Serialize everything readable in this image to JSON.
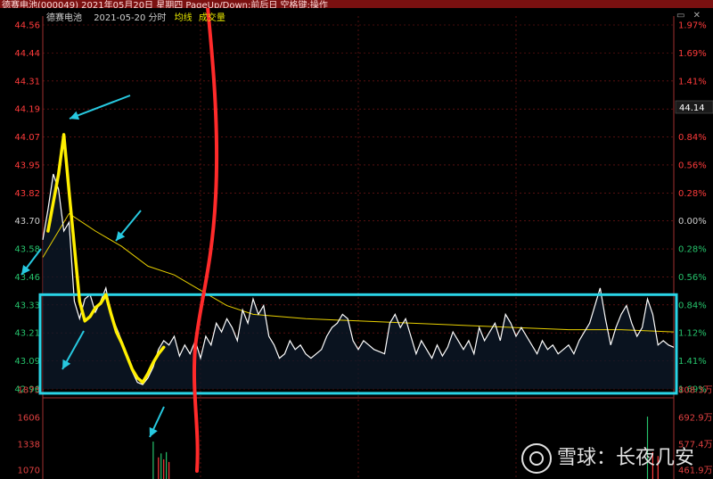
{
  "window": {
    "title": "德赛电池(000049)  2021年05月20日 星期四 PageUp/Down:前后日 空格键:操作"
  },
  "header": {
    "stock": "德赛电池",
    "date_label": "2021-05-20 分时",
    "avg_label": "均线",
    "volume_label": "成交量"
  },
  "price_badge": "44.14",
  "watermark": {
    "site": "雪球",
    "sep": "：",
    "author": "长夜几安"
  },
  "colors": {
    "background": "#000000",
    "grid": "#8b1a1a",
    "price_line": "#ffffff",
    "avg_line": "#e8d000",
    "up": "#ff3b3b",
    "down": "#26c26b",
    "highlight_box": "#2ad4e6",
    "annotation_yellow": "#ffef00",
    "annotation_red": "#ff2a2a",
    "arrow": "#27c9e0"
  },
  "chart_data": {
    "type": "line",
    "left_ticks": [
      "44.56",
      "44.44",
      "44.31",
      "44.19",
      "44.07",
      "43.95",
      "43.82",
      "43.70",
      "43.58",
      "43.46",
      "43.33",
      "43.21",
      "43.09",
      "42.96"
    ],
    "right_ticks": [
      "1.97%",
      "1.69%",
      "1.41%",
      "1.13%",
      "0.84%",
      "0.56%",
      "0.28%",
      "0.00%",
      "0.28%",
      "0.56%",
      "0.84%",
      "1.12%",
      "1.41%",
      "1.69%"
    ],
    "ylim": [
      42.9,
      44.56
    ],
    "volume_ticks_left": [
      "1873",
      "1606",
      "1338",
      "1070"
    ],
    "volume_ticks_right": [
      "808.3万",
      "692.9万",
      "577.4万",
      "461.9万"
    ],
    "x_range": [
      0,
      240
    ],
    "price": {
      "x": [
        0,
        2,
        4,
        6,
        8,
        10,
        12,
        14,
        16,
        18,
        20,
        22,
        24,
        26,
        28,
        30,
        32,
        34,
        36,
        38,
        40,
        42,
        44,
        46,
        48,
        50,
        52,
        54,
        56,
        58,
        60,
        62,
        64,
        66,
        68,
        70,
        72,
        74,
        76,
        78,
        80,
        82,
        84,
        86,
        88,
        90,
        92,
        94,
        96,
        98,
        100,
        102,
        104,
        106,
        108,
        110,
        112,
        114,
        116,
        118,
        120,
        122,
        124,
        126,
        128,
        130,
        132,
        134,
        136,
        138,
        140,
        142,
        144,
        146,
        148,
        150,
        152,
        154,
        156,
        158,
        160,
        162,
        164,
        166,
        168,
        170,
        172,
        174,
        176,
        178,
        180,
        182,
        184,
        186,
        188,
        190,
        192,
        194,
        196,
        198,
        200,
        202,
        204,
        206,
        208,
        210,
        212,
        214,
        216,
        218,
        220,
        222,
        224,
        226,
        228,
        230,
        232,
        234,
        236,
        238,
        240
      ],
      "y": [
        43.58,
        43.72,
        43.88,
        43.81,
        43.62,
        43.66,
        43.3,
        43.22,
        43.31,
        43.33,
        43.25,
        43.3,
        43.36,
        43.24,
        43.18,
        43.12,
        43.05,
        42.98,
        42.93,
        42.92,
        42.95,
        43.0,
        43.08,
        43.12,
        43.1,
        43.14,
        43.05,
        43.1,
        43.06,
        43.12,
        43.04,
        43.14,
        43.1,
        43.2,
        43.16,
        43.22,
        43.18,
        43.12,
        43.26,
        43.2,
        43.31,
        43.24,
        43.28,
        43.14,
        43.1,
        43.04,
        43.06,
        43.12,
        43.08,
        43.1,
        43.06,
        43.04,
        43.06,
        43.08,
        43.14,
        43.18,
        43.2,
        43.24,
        43.22,
        43.12,
        43.08,
        43.12,
        43.1,
        43.08,
        43.07,
        43.06,
        43.2,
        43.24,
        43.18,
        43.22,
        43.14,
        43.06,
        43.12,
        43.08,
        43.04,
        43.1,
        43.05,
        43.09,
        43.16,
        43.12,
        43.08,
        43.12,
        43.06,
        43.18,
        43.12,
        43.16,
        43.2,
        43.12,
        43.24,
        43.2,
        43.14,
        43.18,
        43.14,
        43.1,
        43.06,
        43.12,
        43.08,
        43.1,
        43.06,
        43.08,
        43.1,
        43.06,
        43.12,
        43.16,
        43.2,
        43.28,
        43.36,
        43.22,
        43.1,
        43.18,
        43.24,
        43.28,
        43.2,
        43.14,
        43.18,
        43.31,
        43.24,
        43.1,
        43.12,
        43.1,
        43.09
      ]
    },
    "avg": {
      "x": [
        0,
        10,
        20,
        30,
        40,
        50,
        60,
        70,
        80,
        100,
        120,
        140,
        160,
        180,
        200,
        220,
        240
      ],
      "y": [
        43.5,
        43.7,
        43.62,
        43.55,
        43.46,
        43.42,
        43.35,
        43.28,
        43.24,
        43.22,
        43.21,
        43.2,
        43.19,
        43.18,
        43.17,
        43.17,
        43.16
      ]
    },
    "volume": {
      "x": [
        42,
        44,
        45,
        46,
        47,
        48,
        230,
        232,
        234
      ],
      "v": [
        1420,
        1180,
        1240,
        1150,
        1260,
        1110,
        1800,
        1260,
        1200
      ],
      "color": [
        "down",
        "up",
        "down",
        "up",
        "down",
        "up",
        "down",
        "up",
        "up"
      ]
    },
    "volume_ylim": [
      1000,
      1950
    ]
  },
  "annotations": {
    "highlight_box_price_range": [
      42.88,
      43.33
    ],
    "highlight_box_x": [
      0,
      240
    ],
    "yellow_trace": {
      "x": [
        2,
        6,
        8,
        10,
        12,
        14,
        16,
        18,
        20,
        22,
        24,
        26,
        28,
        30,
        32,
        34,
        36,
        38,
        40,
        42,
        44,
        46
      ],
      "y": [
        43.62,
        43.88,
        44.06,
        43.8,
        43.55,
        43.3,
        43.21,
        43.23,
        43.27,
        43.29,
        43.33,
        43.24,
        43.16,
        43.11,
        43.05,
        42.99,
        42.95,
        42.93,
        42.97,
        43.02,
        43.06,
        43.09
      ]
    }
  }
}
